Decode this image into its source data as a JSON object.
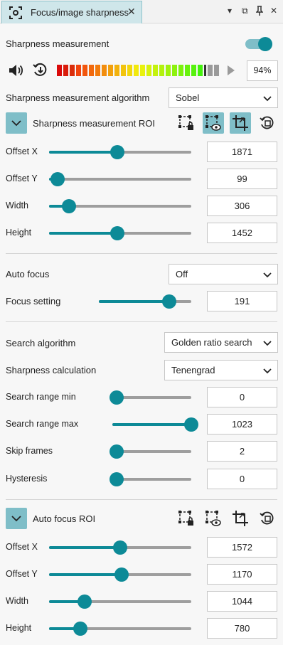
{
  "tab": {
    "title": "Focus/image sharpness",
    "close": "✕"
  },
  "window_buttons": [
    "▾",
    "⧉",
    "📌",
    "✕"
  ],
  "sharpness": {
    "label": "Sharpness measurement",
    "enabled": true,
    "percent": "94%",
    "level": 0.94,
    "algorithm_label": "Sharpness measurement algorithm",
    "algorithm_value": "Sobel",
    "roi_label": "Sharpness measurement ROI",
    "roi": [
      {
        "label": "Offset X",
        "value": "1871",
        "fraction": 0.48
      },
      {
        "label": "Offset Y",
        "value": "99",
        "fraction": 0.06
      },
      {
        "label": "Width",
        "value": "306",
        "fraction": 0.14
      },
      {
        "label": "Height",
        "value": "1452",
        "fraction": 0.48
      }
    ]
  },
  "focus": {
    "auto_focus_label": "Auto focus",
    "auto_focus_value": "Off",
    "setting_label": "Focus setting",
    "setting_value": "191",
    "setting_fraction": 0.76
  },
  "search": {
    "algorithm_label": "Search algorithm",
    "algorithm_value": "Golden ratio search",
    "calc_label": "Sharpness calculation",
    "calc_value": "Tenengrad",
    "params": [
      {
        "label": "Search range min",
        "value": "0",
        "fraction": 0.0
      },
      {
        "label": "Search range max",
        "value": "1023",
        "fraction": 1.0
      },
      {
        "label": "Skip frames",
        "value": "2",
        "fraction": 0.0
      },
      {
        "label": "Hysteresis",
        "value": "0",
        "fraction": 0.0
      }
    ]
  },
  "autofocus_roi": {
    "label": "Auto focus ROI",
    "roi": [
      {
        "label": "Offset X",
        "value": "1572",
        "fraction": 0.5
      },
      {
        "label": "Offset Y",
        "value": "1170",
        "fraction": 0.51
      },
      {
        "label": "Width",
        "value": "1044",
        "fraction": 0.25
      },
      {
        "label": "Height",
        "value": "780",
        "fraction": 0.22
      }
    ]
  },
  "colors": {
    "accent": "#0d8a97",
    "accent_light": "#7fbec8",
    "tab": "#cfe6ea"
  }
}
